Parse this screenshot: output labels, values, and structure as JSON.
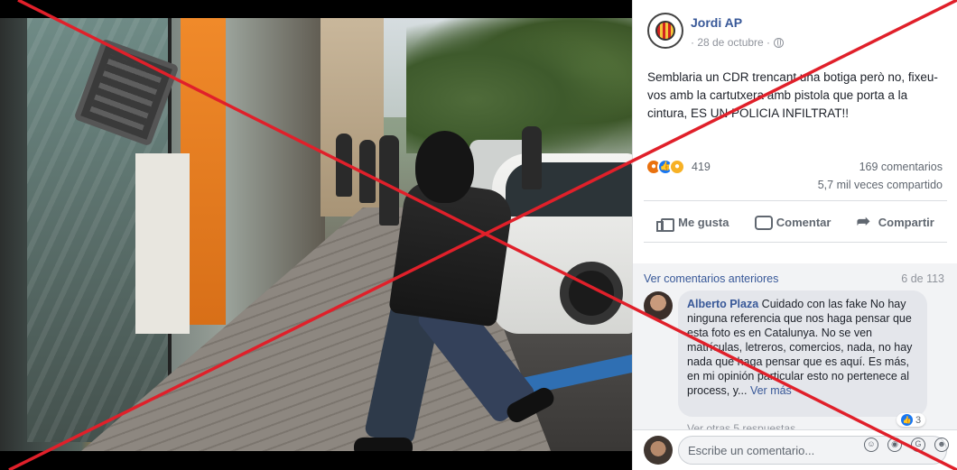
{
  "post": {
    "page_name": "Jordi AP",
    "date": "· 28 de octubre ·",
    "text": "Semblaria un CDR trencant una botiga però no, fixeu-vos amb la cartutxera amb pistola que porta a la cintura, ES UN POLICIA INFILTRAT!!",
    "reaction_count": "419",
    "comments_count": "169 comentarios",
    "shares_count": "5,7 mil veces compartido",
    "reaction_icons": [
      "angry-icon",
      "like-icon",
      "haha-icon"
    ]
  },
  "actions": {
    "like": "Me gusta",
    "comment": "Comentar",
    "share": "Compartir"
  },
  "comments": {
    "view_previous": "Ver comentarios anteriores",
    "page_count": "6 de 113",
    "items": [
      {
        "author": "Alberto Plaza",
        "text": "Cuidado con las fake No hay ninguna referencia que nos haga pensar que esta foto es en Catalunya. No se ven matrículas, letreros, comercios, nada, no hay nada que haga pensar que es aquí. Es más, en mi opinión particular esto no pertenece al process, y...",
        "see_more": "Ver más",
        "likes": "3"
      }
    ],
    "partial_reply": "Ver otras 5 respuestas"
  },
  "composer": {
    "placeholder": "Escribe un comentario..."
  },
  "colors": {
    "link": "#385898",
    "cross": "#e0202a"
  }
}
